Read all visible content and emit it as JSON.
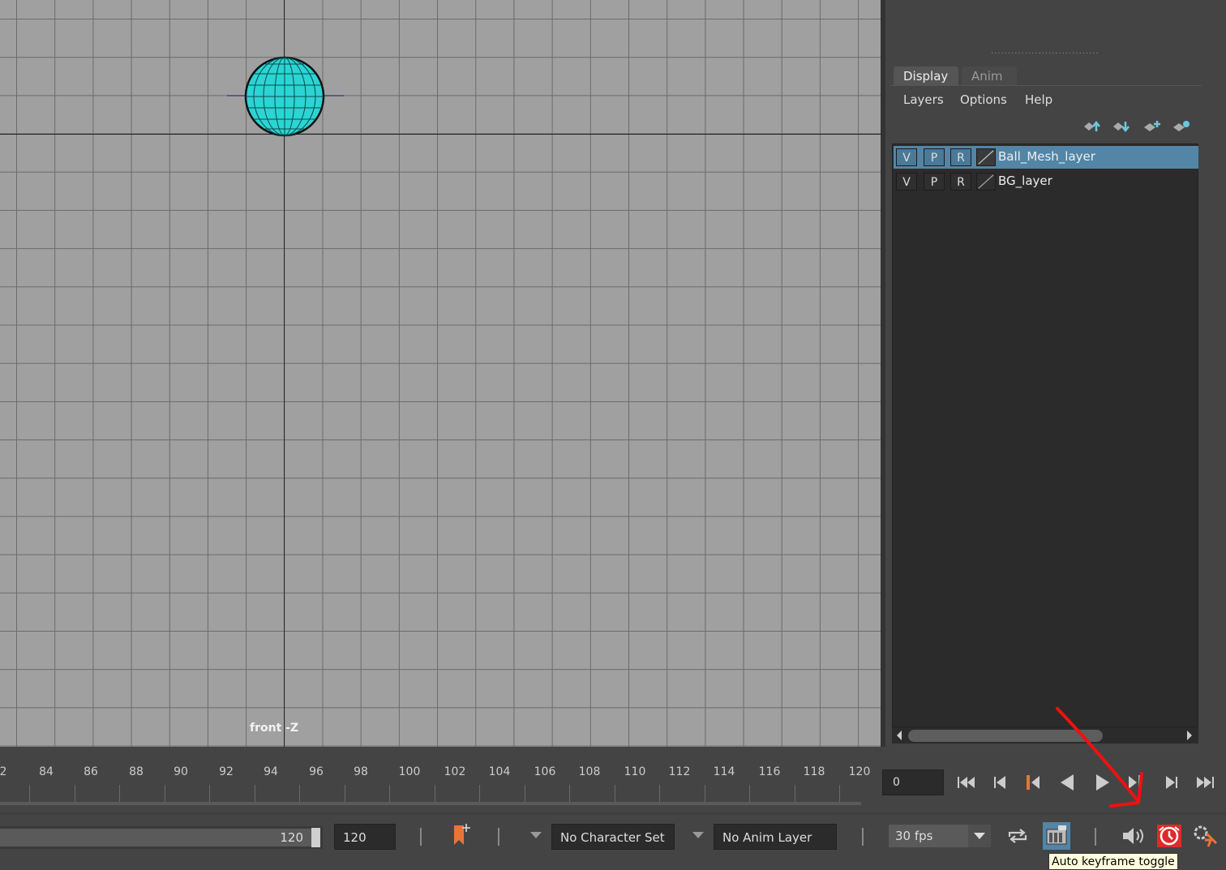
{
  "viewport": {
    "camera_label": "front -Z"
  },
  "layer_editor": {
    "tabs": [
      {
        "label": "Display",
        "active": true
      },
      {
        "label": "Anim",
        "active": false
      }
    ],
    "menus": [
      "Layers",
      "Options",
      "Help"
    ],
    "toolbar_icons": [
      "move-layer-up-icon",
      "move-layer-down-icon",
      "new-empty-layer-icon",
      "new-layer-from-selected-icon"
    ],
    "layers": [
      {
        "name": "Ball_Mesh_layer",
        "v": "V",
        "p": "P",
        "r": "R",
        "selected": true
      },
      {
        "name": "BG_layer",
        "v": "V",
        "p": "P",
        "r": "R",
        "selected": false
      }
    ]
  },
  "timeline": {
    "ticks": [
      "2",
      "84",
      "86",
      "88",
      "90",
      "92",
      "94",
      "96",
      "98",
      "100",
      "102",
      "104",
      "106",
      "108",
      "110",
      "112",
      "114",
      "116",
      "118",
      "120"
    ],
    "current_frame": "0"
  },
  "range": {
    "slider_end": "120",
    "end_field": "120",
    "character_set": "No Character Set",
    "anim_layer": "No Anim Layer",
    "fps": "30 fps",
    "tooltip": "Auto keyframe toggle"
  },
  "colors": {
    "ball": "#2cd4d4",
    "selected_row": "#5285a6",
    "accent_red": "#e02a2a",
    "key_orange": "#e8743a"
  }
}
